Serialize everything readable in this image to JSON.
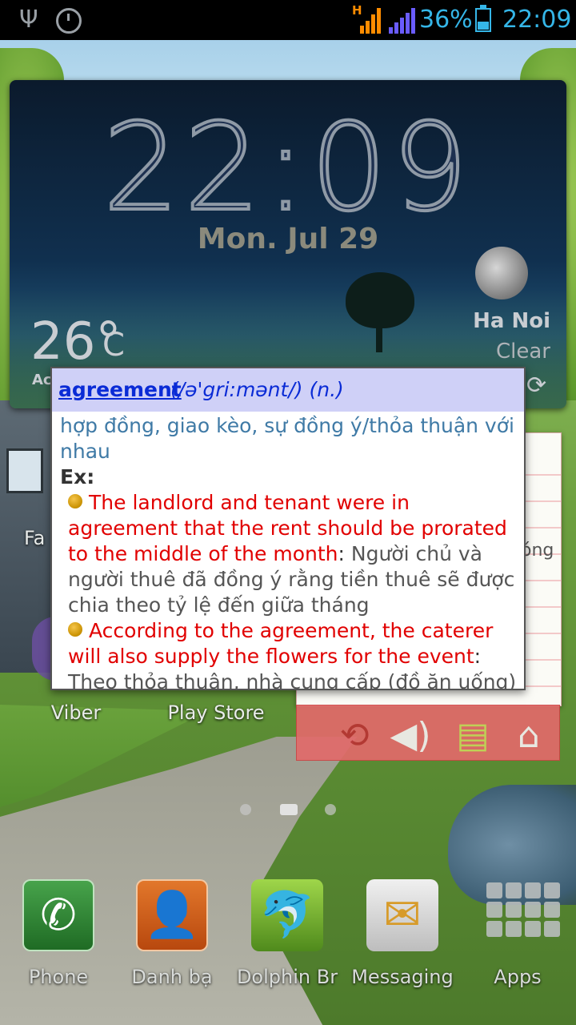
{
  "status_bar": {
    "network_type": "H",
    "battery_percent": "36%",
    "time": "22:09",
    "icons": [
      "usb-icon",
      "alarm-icon",
      "signal-h-icon",
      "signal-bars-icon",
      "battery-charging-icon"
    ]
  },
  "clock_widget": {
    "time": "22:09",
    "date": "Mon. Jul 29",
    "temperature": "26°",
    "temperature_unit": "C",
    "abbr": "Ac",
    "city": "Ha Noi",
    "condition": "Clear"
  },
  "home_icons": {
    "viber": "Viber",
    "play_store": "Play Store",
    "fa_fragment": "Fa"
  },
  "notes_widget": {
    "fragment": "óng"
  },
  "dictionary_popup": {
    "headword": "agreement",
    "phonetic": "(/ə'gri:mənt/)",
    "part_of_speech": "(n.)",
    "meaning": "hợp đồng, giao kèo, sự đồng ý/thỏa thuận với nhau",
    "ex_label": "Ex:",
    "examples": [
      {
        "en": "The landlord and tenant were in agreement that the rent should be prorated to the middle of the month",
        "colon": ":",
        "vi": " Người chủ và người thuê đã đồng ý rằng tiền thuê sẽ được chia theo tỷ lệ đến giữa tháng"
      },
      {
        "en": "According to the agreement, the caterer will also supply the flowers for the event",
        "colon": ":",
        "vi": "Theo thỏa thuận, nhà cung cấp (đồ ăn uống)"
      }
    ]
  },
  "dock": {
    "phone": "Phone",
    "contacts": "Danh bạ",
    "dolphin": "Dolphin Br",
    "messaging": "Messaging",
    "apps": "Apps"
  },
  "page_indicator": {
    "pages": 3,
    "active": 2
  },
  "colors": {
    "status_text": "#35b6e8",
    "popup_header": "#cfd0f7",
    "headword": "#0a2bd6",
    "meaning": "#3f7aa6",
    "example_en": "#e10000"
  }
}
